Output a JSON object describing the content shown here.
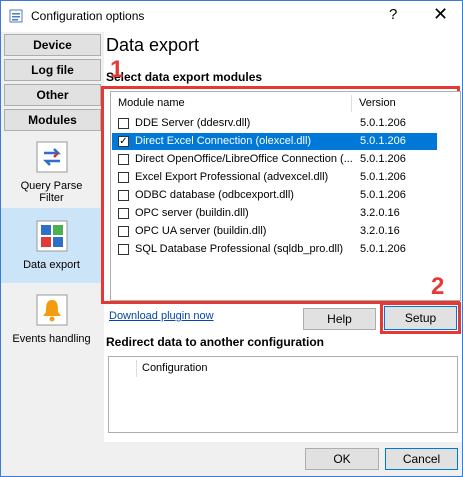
{
  "window": {
    "title": "Configuration options",
    "help_glyph": "?",
    "close_glyph": "✕"
  },
  "sidebar": {
    "tabs": [
      {
        "label": "Device"
      },
      {
        "label": "Log file"
      },
      {
        "label": "Other"
      },
      {
        "label": "Modules"
      }
    ],
    "items": [
      {
        "label": "Query Parse Filter",
        "icon": "query-parse-icon"
      },
      {
        "label": "Data export",
        "icon": "data-export-icon",
        "selected": true
      },
      {
        "label": "Events handling",
        "icon": "bell-icon"
      }
    ]
  },
  "main": {
    "title": "Data export",
    "modules_label": "Select data export modules",
    "columns": {
      "name": "Module name",
      "version": "Version"
    },
    "modules": [
      {
        "name": "DDE Server (ddesrv.dll)",
        "version": "5.0.1.206",
        "checked": false
      },
      {
        "name": "Direct Excel Connection (olexcel.dll)",
        "version": "5.0.1.206",
        "checked": true,
        "selected": true
      },
      {
        "name": "Direct OpenOffice/LibreOffice Connection (...",
        "version": "5.0.1.206",
        "checked": false
      },
      {
        "name": "Excel Export Professional (advexcel.dll)",
        "version": "5.0.1.206",
        "checked": false
      },
      {
        "name": "ODBC database (odbcexport.dll)",
        "version": "5.0.1.206",
        "checked": false
      },
      {
        "name": "OPC server (buildin.dll)",
        "version": "3.2.0.16",
        "checked": false
      },
      {
        "name": "OPC UA server (buildin.dll)",
        "version": "3.2.0.16",
        "checked": false
      },
      {
        "name": "SQL Database Professional (sqldb_pro.dll)",
        "version": "5.0.1.206",
        "checked": false
      }
    ],
    "download_link": "Download plugin now",
    "help_button": "Help",
    "setup_button": "Setup",
    "redirect_label": "Redirect data to another configuration",
    "redirect_column": "Configuration",
    "callout_1": "1",
    "callout_2": "2"
  },
  "footer": {
    "ok": "OK",
    "cancel": "Cancel"
  },
  "colors": {
    "selection": "#0078d7",
    "callout": "#e53935",
    "link": "#0645ad"
  }
}
